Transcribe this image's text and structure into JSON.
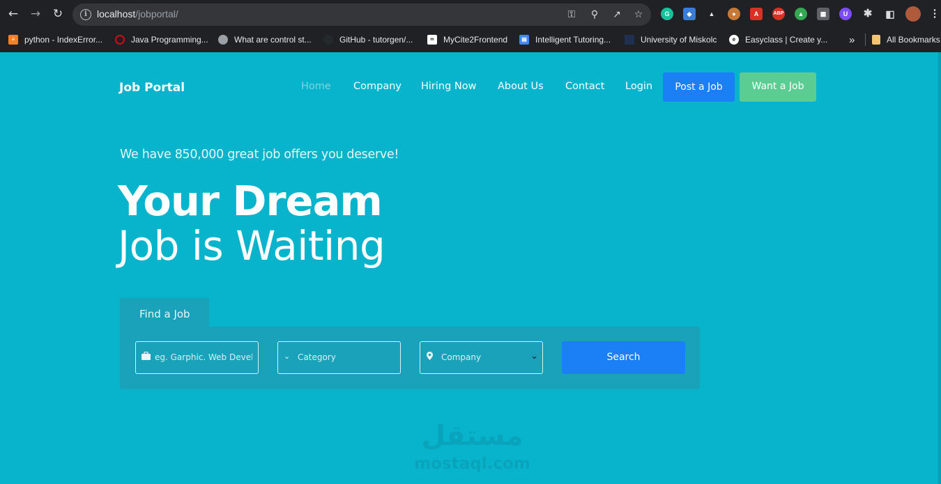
{
  "browser": {
    "url_host": "localhost",
    "url_path": "/jobportal/",
    "bookmarks": [
      {
        "label": "python - IndexError...",
        "icon": "stackoverflow-icon",
        "color": "#f48024"
      },
      {
        "label": "Java Programming...",
        "icon": "opera-icon",
        "color": "#cc0f16"
      },
      {
        "label": "What are control st...",
        "icon": "globe-icon",
        "color": "#9aa0a6"
      },
      {
        "label": "GitHub - tutorgen/...",
        "icon": "github-icon",
        "color": "#24292e"
      },
      {
        "label": "MyCite2Frontend",
        "icon": "mycite-icon",
        "color": "#ffffff"
      },
      {
        "label": "Intelligent Tutoring...",
        "icon": "doc-icon",
        "color": "#4285f4"
      },
      {
        "label": "University of Miskolc",
        "icon": "university-icon",
        "color": "#203050"
      },
      {
        "label": "Easyclass | Create y...",
        "icon": "easyclass-icon",
        "color": "#ffffff"
      },
      {
        "label": "All Bookmarks",
        "icon": "folder-icon",
        "color": "#f3c66b"
      }
    ],
    "overflow_label": "»"
  },
  "site": {
    "brand": "Job Portal",
    "nav": [
      "Home",
      "Company",
      "Hiring Now",
      "About Us",
      "Contact",
      "Login"
    ],
    "post_job": "Post a Job",
    "want_job": "Want a Job",
    "tagline": "We have 850,000 great job offers you deserve!",
    "hero_line1": "Your Dream",
    "hero_line2": "Job is Waiting",
    "find_tab": "Find a Job",
    "keyword_placeholder": "eg. Garphic. Web Develc",
    "category_placeholder": "Category",
    "company_select": "Company",
    "search_label": "Search"
  },
  "watermark": {
    "arabic": "مستقل",
    "latin": "mostaql.com"
  },
  "colors": {
    "page_bg": "#08b3cc",
    "panel_bg": "#1ba2bb",
    "primary_button": "#1b7ff5",
    "success_button": "#5ccd92",
    "active_nav": "#7fd3e2"
  }
}
